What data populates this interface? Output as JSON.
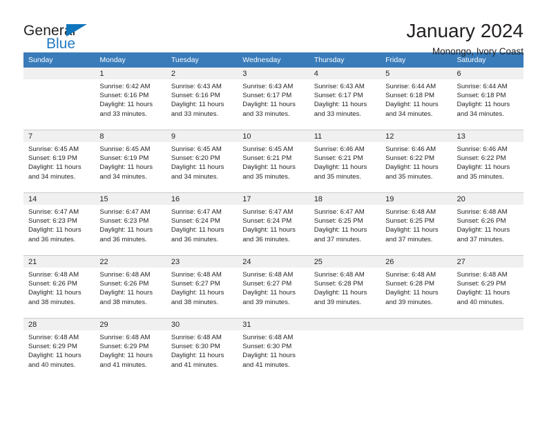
{
  "brand": {
    "name_dark": "General",
    "name_blue": "Blue",
    "accent_color": "#1075bd"
  },
  "header": {
    "title": "January 2024",
    "location": "Monongo, Ivory Coast"
  },
  "calendar": {
    "header_bg": "#3a7cba",
    "daynum_bg": "#f0f0f0",
    "weekday_labels": [
      "Sunday",
      "Monday",
      "Tuesday",
      "Wednesday",
      "Thursday",
      "Friday",
      "Saturday"
    ],
    "weeks": [
      [
        {
          "day": "",
          "blank": true,
          "sunrise": "",
          "sunset": "",
          "daylight1": "",
          "daylight2": ""
        },
        {
          "day": "1",
          "sunrise": "Sunrise: 6:42 AM",
          "sunset": "Sunset: 6:16 PM",
          "daylight1": "Daylight: 11 hours",
          "daylight2": "and 33 minutes."
        },
        {
          "day": "2",
          "sunrise": "Sunrise: 6:43 AM",
          "sunset": "Sunset: 6:16 PM",
          "daylight1": "Daylight: 11 hours",
          "daylight2": "and 33 minutes."
        },
        {
          "day": "3",
          "sunrise": "Sunrise: 6:43 AM",
          "sunset": "Sunset: 6:17 PM",
          "daylight1": "Daylight: 11 hours",
          "daylight2": "and 33 minutes."
        },
        {
          "day": "4",
          "sunrise": "Sunrise: 6:43 AM",
          "sunset": "Sunset: 6:17 PM",
          "daylight1": "Daylight: 11 hours",
          "daylight2": "and 33 minutes."
        },
        {
          "day": "5",
          "sunrise": "Sunrise: 6:44 AM",
          "sunset": "Sunset: 6:18 PM",
          "daylight1": "Daylight: 11 hours",
          "daylight2": "and 34 minutes."
        },
        {
          "day": "6",
          "sunrise": "Sunrise: 6:44 AM",
          "sunset": "Sunset: 6:18 PM",
          "daylight1": "Daylight: 11 hours",
          "daylight2": "and 34 minutes."
        }
      ],
      [
        {
          "day": "7",
          "sunrise": "Sunrise: 6:45 AM",
          "sunset": "Sunset: 6:19 PM",
          "daylight1": "Daylight: 11 hours",
          "daylight2": "and 34 minutes."
        },
        {
          "day": "8",
          "sunrise": "Sunrise: 6:45 AM",
          "sunset": "Sunset: 6:19 PM",
          "daylight1": "Daylight: 11 hours",
          "daylight2": "and 34 minutes."
        },
        {
          "day": "9",
          "sunrise": "Sunrise: 6:45 AM",
          "sunset": "Sunset: 6:20 PM",
          "daylight1": "Daylight: 11 hours",
          "daylight2": "and 34 minutes."
        },
        {
          "day": "10",
          "sunrise": "Sunrise: 6:45 AM",
          "sunset": "Sunset: 6:21 PM",
          "daylight1": "Daylight: 11 hours",
          "daylight2": "and 35 minutes."
        },
        {
          "day": "11",
          "sunrise": "Sunrise: 6:46 AM",
          "sunset": "Sunset: 6:21 PM",
          "daylight1": "Daylight: 11 hours",
          "daylight2": "and 35 minutes."
        },
        {
          "day": "12",
          "sunrise": "Sunrise: 6:46 AM",
          "sunset": "Sunset: 6:22 PM",
          "daylight1": "Daylight: 11 hours",
          "daylight2": "and 35 minutes."
        },
        {
          "day": "13",
          "sunrise": "Sunrise: 6:46 AM",
          "sunset": "Sunset: 6:22 PM",
          "daylight1": "Daylight: 11 hours",
          "daylight2": "and 35 minutes."
        }
      ],
      [
        {
          "day": "14",
          "sunrise": "Sunrise: 6:47 AM",
          "sunset": "Sunset: 6:23 PM",
          "daylight1": "Daylight: 11 hours",
          "daylight2": "and 36 minutes."
        },
        {
          "day": "15",
          "sunrise": "Sunrise: 6:47 AM",
          "sunset": "Sunset: 6:23 PM",
          "daylight1": "Daylight: 11 hours",
          "daylight2": "and 36 minutes."
        },
        {
          "day": "16",
          "sunrise": "Sunrise: 6:47 AM",
          "sunset": "Sunset: 6:24 PM",
          "daylight1": "Daylight: 11 hours",
          "daylight2": "and 36 minutes."
        },
        {
          "day": "17",
          "sunrise": "Sunrise: 6:47 AM",
          "sunset": "Sunset: 6:24 PM",
          "daylight1": "Daylight: 11 hours",
          "daylight2": "and 36 minutes."
        },
        {
          "day": "18",
          "sunrise": "Sunrise: 6:47 AM",
          "sunset": "Sunset: 6:25 PM",
          "daylight1": "Daylight: 11 hours",
          "daylight2": "and 37 minutes."
        },
        {
          "day": "19",
          "sunrise": "Sunrise: 6:48 AM",
          "sunset": "Sunset: 6:25 PM",
          "daylight1": "Daylight: 11 hours",
          "daylight2": "and 37 minutes."
        },
        {
          "day": "20",
          "sunrise": "Sunrise: 6:48 AM",
          "sunset": "Sunset: 6:26 PM",
          "daylight1": "Daylight: 11 hours",
          "daylight2": "and 37 minutes."
        }
      ],
      [
        {
          "day": "21",
          "sunrise": "Sunrise: 6:48 AM",
          "sunset": "Sunset: 6:26 PM",
          "daylight1": "Daylight: 11 hours",
          "daylight2": "and 38 minutes."
        },
        {
          "day": "22",
          "sunrise": "Sunrise: 6:48 AM",
          "sunset": "Sunset: 6:26 PM",
          "daylight1": "Daylight: 11 hours",
          "daylight2": "and 38 minutes."
        },
        {
          "day": "23",
          "sunrise": "Sunrise: 6:48 AM",
          "sunset": "Sunset: 6:27 PM",
          "daylight1": "Daylight: 11 hours",
          "daylight2": "and 38 minutes."
        },
        {
          "day": "24",
          "sunrise": "Sunrise: 6:48 AM",
          "sunset": "Sunset: 6:27 PM",
          "daylight1": "Daylight: 11 hours",
          "daylight2": "and 39 minutes."
        },
        {
          "day": "25",
          "sunrise": "Sunrise: 6:48 AM",
          "sunset": "Sunset: 6:28 PM",
          "daylight1": "Daylight: 11 hours",
          "daylight2": "and 39 minutes."
        },
        {
          "day": "26",
          "sunrise": "Sunrise: 6:48 AM",
          "sunset": "Sunset: 6:28 PM",
          "daylight1": "Daylight: 11 hours",
          "daylight2": "and 39 minutes."
        },
        {
          "day": "27",
          "sunrise": "Sunrise: 6:48 AM",
          "sunset": "Sunset: 6:29 PM",
          "daylight1": "Daylight: 11 hours",
          "daylight2": "and 40 minutes."
        }
      ],
      [
        {
          "day": "28",
          "sunrise": "Sunrise: 6:48 AM",
          "sunset": "Sunset: 6:29 PM",
          "daylight1": "Daylight: 11 hours",
          "daylight2": "and 40 minutes."
        },
        {
          "day": "29",
          "sunrise": "Sunrise: 6:48 AM",
          "sunset": "Sunset: 6:29 PM",
          "daylight1": "Daylight: 11 hours",
          "daylight2": "and 41 minutes."
        },
        {
          "day": "30",
          "sunrise": "Sunrise: 6:48 AM",
          "sunset": "Sunset: 6:30 PM",
          "daylight1": "Daylight: 11 hours",
          "daylight2": "and 41 minutes."
        },
        {
          "day": "31",
          "sunrise": "Sunrise: 6:48 AM",
          "sunset": "Sunset: 6:30 PM",
          "daylight1": "Daylight: 11 hours",
          "daylight2": "and 41 minutes."
        },
        {
          "day": "",
          "blank": true,
          "sunrise": "",
          "sunset": "",
          "daylight1": "",
          "daylight2": ""
        },
        {
          "day": "",
          "blank": true,
          "sunrise": "",
          "sunset": "",
          "daylight1": "",
          "daylight2": ""
        },
        {
          "day": "",
          "blank": true,
          "sunrise": "",
          "sunset": "",
          "daylight1": "",
          "daylight2": ""
        }
      ]
    ]
  }
}
